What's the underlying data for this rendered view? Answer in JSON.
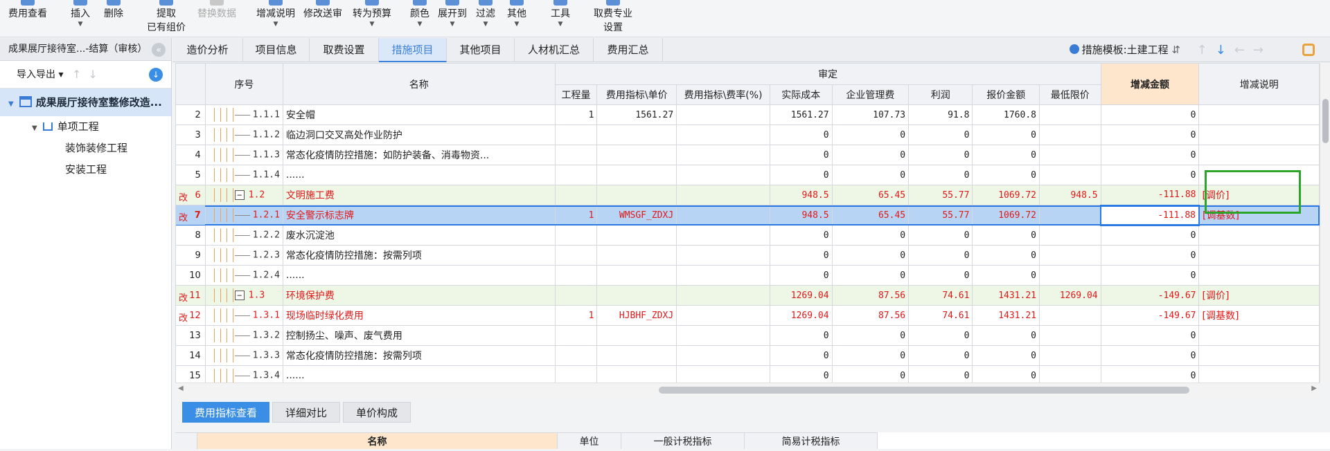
{
  "toolbar": {
    "buttons": [
      {
        "label": "费用查看",
        "sub": "",
        "caret": false,
        "disabled": false
      },
      {
        "label": "插入",
        "sub": "",
        "caret": true,
        "disabled": false
      },
      {
        "label": "删除",
        "sub": "",
        "caret": false,
        "disabled": false
      },
      {
        "label": "提取",
        "sub": "已有组价",
        "caret": false,
        "disabled": false
      },
      {
        "label": "替换数据",
        "sub": "",
        "caret": false,
        "disabled": true
      },
      {
        "label": "增减说明",
        "sub": "",
        "caret": true,
        "disabled": false
      },
      {
        "label": "修改送审",
        "sub": "",
        "caret": false,
        "disabled": false
      },
      {
        "label": "转为预算",
        "sub": "",
        "caret": true,
        "disabled": false
      },
      {
        "label": "颜色",
        "sub": "",
        "caret": true,
        "disabled": false
      },
      {
        "label": "展开到",
        "sub": "",
        "caret": true,
        "disabled": false
      },
      {
        "label": "过滤",
        "sub": "",
        "caret": true,
        "disabled": false
      },
      {
        "label": "其他",
        "sub": "",
        "caret": true,
        "disabled": false
      },
      {
        "label": "工具",
        "sub": "",
        "caret": true,
        "disabled": false
      },
      {
        "label": "取费专业",
        "sub": "设置",
        "caret": false,
        "disabled": false
      }
    ]
  },
  "left_panel": {
    "title": "成果展厅接待室...-结算（审核）",
    "import_export": "导入导出",
    "tree": {
      "root": "成果展厅接待室整修改造...",
      "level1": "单项工程",
      "children": [
        "装饰装修工程",
        "安装工程"
      ]
    }
  },
  "tabs": [
    "造价分析",
    "项目信息",
    "取费设置",
    "措施项目",
    "其他项目",
    "人材机汇总",
    "费用汇总"
  ],
  "active_tab": "措施项目",
  "template_label": "措施模板:土建工程",
  "grid": {
    "headers": {
      "seq": "序号",
      "name": "名称",
      "group": "审定",
      "qty": "工程量",
      "unit_price": "费用指标\\单价",
      "rate": "费用指标\\费率(%)",
      "cost": "实际成本",
      "mgmt": "企业管理费",
      "profit": "利润",
      "quote": "报价金额",
      "min_price": "最低限价",
      "delta": "增减金额",
      "delta_note": "增减说明"
    },
    "rows": [
      {
        "rn": "2",
        "mark": "",
        "seq": "1.1.1",
        "group": false,
        "name": "安全帽",
        "qty": "1",
        "unit_price": "1561.27",
        "rate": "",
        "cost": "1561.27",
        "mgmt": "107.73",
        "profit": "91.8",
        "quote": "1760.8",
        "min_price": "",
        "delta": "0",
        "note": ""
      },
      {
        "rn": "3",
        "mark": "",
        "seq": "1.1.2",
        "group": false,
        "name": "临边洞口交叉高处作业防护",
        "qty": "",
        "unit_price": "",
        "rate": "",
        "cost": "0",
        "mgmt": "0",
        "profit": "0",
        "quote": "0",
        "min_price": "",
        "delta": "0",
        "note": ""
      },
      {
        "rn": "4",
        "mark": "",
        "seq": "1.1.3",
        "group": false,
        "name": "常态化疫情防控措施：如防护装备、消毒物资...",
        "qty": "",
        "unit_price": "",
        "rate": "",
        "cost": "0",
        "mgmt": "0",
        "profit": "0",
        "quote": "0",
        "min_price": "",
        "delta": "0",
        "note": ""
      },
      {
        "rn": "5",
        "mark": "",
        "seq": "1.1.4",
        "group": false,
        "name": "......",
        "qty": "",
        "unit_price": "",
        "rate": "",
        "cost": "0",
        "mgmt": "0",
        "profit": "0",
        "quote": "0",
        "min_price": "",
        "delta": "0",
        "note": ""
      },
      {
        "rn": "6",
        "mark": "改",
        "seq": "1.2",
        "group": true,
        "name": "文明施工费",
        "qty": "",
        "unit_price": "",
        "rate": "",
        "cost": "948.5",
        "mgmt": "65.45",
        "profit": "55.77",
        "quote": "1069.72",
        "min_price": "948.5",
        "delta": "-111.88",
        "note": "[调价]"
      },
      {
        "rn": "7",
        "mark": "改",
        "seq": "1.2.1",
        "group": false,
        "name": "安全警示标志牌",
        "qty": "1",
        "unit_price": "WMSGF_ZDXJ",
        "rate": "",
        "cost": "948.5",
        "mgmt": "65.45",
        "profit": "55.77",
        "quote": "1069.72",
        "min_price": "",
        "delta": "-111.88",
        "note": "[调基数]",
        "selected": true
      },
      {
        "rn": "8",
        "mark": "",
        "seq": "1.2.2",
        "group": false,
        "name": "废水沉淀池",
        "qty": "",
        "unit_price": "",
        "rate": "",
        "cost": "0",
        "mgmt": "0",
        "profit": "0",
        "quote": "0",
        "min_price": "",
        "delta": "0",
        "note": ""
      },
      {
        "rn": "9",
        "mark": "",
        "seq": "1.2.3",
        "group": false,
        "name": "常态化疫情防控措施：按需列项",
        "qty": "",
        "unit_price": "",
        "rate": "",
        "cost": "0",
        "mgmt": "0",
        "profit": "0",
        "quote": "0",
        "min_price": "",
        "delta": "0",
        "note": ""
      },
      {
        "rn": "10",
        "mark": "",
        "seq": "1.2.4",
        "group": false,
        "name": "......",
        "qty": "",
        "unit_price": "",
        "rate": "",
        "cost": "0",
        "mgmt": "0",
        "profit": "0",
        "quote": "0",
        "min_price": "",
        "delta": "0",
        "note": ""
      },
      {
        "rn": "11",
        "mark": "改",
        "seq": "1.3",
        "group": true,
        "name": "环境保护费",
        "qty": "",
        "unit_price": "",
        "rate": "",
        "cost": "1269.04",
        "mgmt": "87.56",
        "profit": "74.61",
        "quote": "1431.21",
        "min_price": "1269.04",
        "delta": "-149.67",
        "note": "[调价]"
      },
      {
        "rn": "12",
        "mark": "改",
        "seq": "1.3.1",
        "group": false,
        "name": "现场临时绿化费用",
        "qty": "1",
        "unit_price": "HJBHF_ZDXJ",
        "rate": "",
        "cost": "1269.04",
        "mgmt": "87.56",
        "profit": "74.61",
        "quote": "1431.21",
        "min_price": "",
        "delta": "-149.67",
        "note": "[调基数]"
      },
      {
        "rn": "13",
        "mark": "",
        "seq": "1.3.2",
        "group": false,
        "name": "控制扬尘、噪声、废气费用",
        "qty": "",
        "unit_price": "",
        "rate": "",
        "cost": "0",
        "mgmt": "0",
        "profit": "0",
        "quote": "0",
        "min_price": "",
        "delta": "0",
        "note": ""
      },
      {
        "rn": "14",
        "mark": "",
        "seq": "1.3.3",
        "group": false,
        "name": "常态化疫情防控措施：按需列项",
        "qty": "",
        "unit_price": "",
        "rate": "",
        "cost": "0",
        "mgmt": "0",
        "profit": "0",
        "quote": "0",
        "min_price": "",
        "delta": "0",
        "note": ""
      },
      {
        "rn": "15",
        "mark": "",
        "seq": "1.3.4",
        "group": false,
        "name": "......",
        "qty": "",
        "unit_price": "",
        "rate": "",
        "cost": "0",
        "mgmt": "0",
        "profit": "0",
        "quote": "0",
        "min_price": "",
        "delta": "0",
        "note": ""
      }
    ]
  },
  "bottom_tabs": [
    "费用指标查看",
    "详细对比",
    "单价构成"
  ],
  "bottom_active": "费用指标查看",
  "bottom_headers": [
    "名称",
    "单位",
    "一般计税指标",
    "简易计税指标"
  ],
  "colors": {
    "accent": "#3a8ee6",
    "changed": "#e01818",
    "highlight_box": "#2aa52a",
    "header_highlight": "#fde6cc"
  }
}
